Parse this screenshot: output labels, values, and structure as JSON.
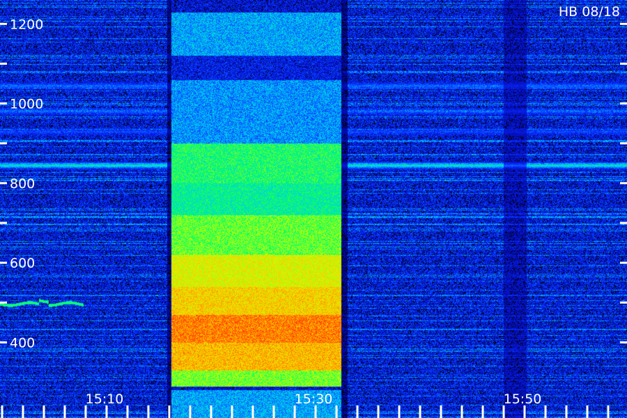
{
  "chart_data": {
    "type": "heatmap",
    "title": "",
    "xlabel": "",
    "ylabel": "",
    "annotation": "HB 08/18",
    "x_ticks": [
      "15:10",
      "15:30",
      "15:50"
    ],
    "y_ticks": [
      400,
      600,
      800,
      1000,
      1200
    ],
    "y_range": [
      280,
      1260
    ],
    "x_range_minutes": [
      0,
      60
    ],
    "x_tick_minutes": [
      10,
      30,
      50
    ],
    "minor_y_step": 100,
    "minor_x_step_minutes": 2,
    "grid": false,
    "colormap": [
      "#00008c",
      "#0a28ff",
      "#00c8ff",
      "#00ff64",
      "#c8ff00",
      "#ffc800",
      "#ff3c00"
    ],
    "background_level": 0.15,
    "bright_block": {
      "x_start_minutes": 16.4,
      "x_end_minutes": 32.6,
      "bands": [
        {
          "y_from": 1230,
          "y_to": 1120,
          "level": 0.3
        },
        {
          "y_from": 1120,
          "y_to": 1060,
          "level": 0.12
        },
        {
          "y_from": 1060,
          "y_to": 900,
          "level": 0.28
        },
        {
          "y_from": 900,
          "y_to": 800,
          "level": 0.5
        },
        {
          "y_from": 800,
          "y_to": 720,
          "level": 0.45
        },
        {
          "y_from": 720,
          "y_to": 620,
          "level": 0.58
        },
        {
          "y_from": 620,
          "y_to": 540,
          "level": 0.72
        },
        {
          "y_from": 540,
          "y_to": 470,
          "level": 0.8
        },
        {
          "y_from": 470,
          "y_to": 400,
          "level": 0.92
        },
        {
          "y_from": 400,
          "y_to": 330,
          "level": 0.84
        },
        {
          "y_from": 330,
          "y_to": 290,
          "level": 0.6
        }
      ]
    },
    "steady_lines": [
      {
        "y": 845,
        "level": 0.42
      },
      {
        "y": 1045,
        "level": 0.25
      },
      {
        "y": 980,
        "level": 0.22
      },
      {
        "y": 930,
        "level": 0.2
      }
    ],
    "drifting_line": {
      "y": 497,
      "x_start_minutes": 0,
      "x_end_minutes": 8,
      "level": 0.55
    }
  }
}
